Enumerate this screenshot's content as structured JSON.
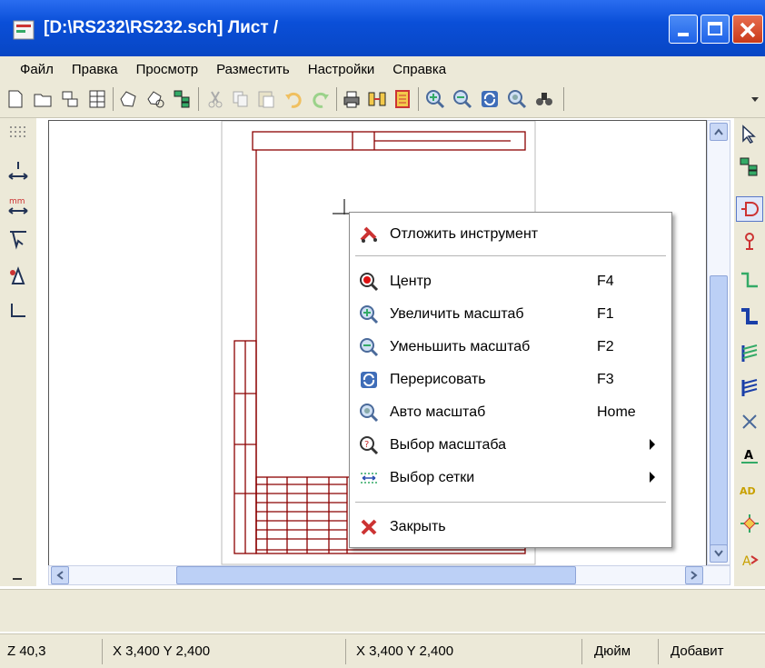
{
  "window": {
    "title": "[D:\\RS232\\RS232.sch]  Лист /"
  },
  "menu": [
    "Файл",
    "Правка",
    "Просмотр",
    "Разместить",
    "Настройки",
    "Справка"
  ],
  "context_menu": {
    "items": [
      {
        "label": "Отложить инструмент",
        "key": "",
        "icon": "wrench-icon"
      },
      {
        "label": "Центр",
        "key": "F4",
        "icon": "zoom-center-icon"
      },
      {
        "label": "Увеличить масштаб",
        "key": "F1",
        "icon": "zoom-in-icon"
      },
      {
        "label": "Уменьшить масштаб",
        "key": "F2",
        "icon": "zoom-out-icon"
      },
      {
        "label": "Перерисовать",
        "key": "F3",
        "icon": "redraw-icon"
      },
      {
        "label": "Авто масштаб",
        "key": "Home",
        "icon": "zoom-auto-icon"
      },
      {
        "label": "Выбор масштаба",
        "key": "",
        "icon": "zoom-select-icon",
        "submenu": true
      },
      {
        "label": "Выбор сетки",
        "key": "",
        "icon": "grid-icon",
        "submenu": true
      },
      {
        "label": "Закрыть",
        "key": "",
        "icon": "close-icon"
      }
    ]
  },
  "status": {
    "zoom": "Z 40,3",
    "coords_abs": "X 3,400  Y 2,400",
    "coords_rel": "X 3,400  Y 2,400",
    "units": "Дюйм",
    "mode": "Добавит"
  },
  "colors": {
    "titlebar": "#0a4fd8",
    "sheet_border": "#8b0000",
    "menu_bg": "#ece9d8"
  }
}
